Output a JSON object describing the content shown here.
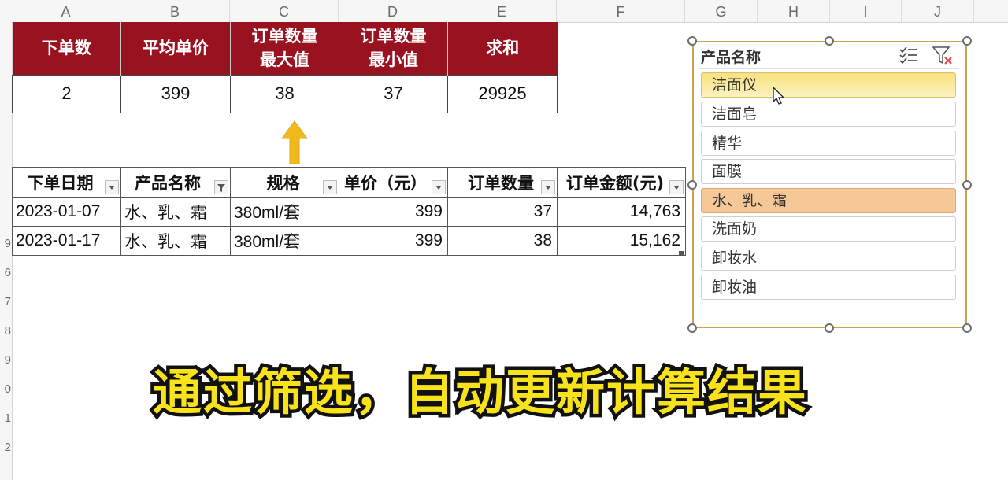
{
  "columns": [
    "A",
    "B",
    "C",
    "D",
    "E",
    "F",
    "G",
    "H",
    "I",
    "J"
  ],
  "rows": [
    "9",
    "6",
    "7",
    "8",
    "9",
    "0",
    "1",
    "2"
  ],
  "summary": {
    "headers": [
      [
        "下单数"
      ],
      [
        "平均单价"
      ],
      [
        "订单数量",
        "最大值"
      ],
      [
        "订单数量",
        "最小值"
      ],
      [
        "求和"
      ]
    ],
    "values": [
      "2",
      "399",
      "38",
      "37",
      "29925"
    ]
  },
  "table": {
    "headers": [
      "下单日期",
      "产品名称",
      "规格",
      "单价（元）",
      "订单数量",
      "订单金额(元)"
    ],
    "rows": [
      [
        "2023-01-07",
        "水、乳、霜",
        "380ml/套",
        "399",
        "37",
        "14,763"
      ],
      [
        "2023-01-17",
        "水、乳、霜",
        "380ml/套",
        "399",
        "38",
        "15,162"
      ]
    ]
  },
  "slicer": {
    "title": "产品名称",
    "items": [
      "洁面仪",
      "洁面皂",
      "精华",
      "面膜",
      "水、乳、霜",
      "洗面奶",
      "卸妆水",
      "卸妆油"
    ],
    "hovered": "洁面仪",
    "selected": "水、乳、霜",
    "multi_select_icon": "multi-select-icon",
    "clear_filter_icon": "clear-filter-icon"
  },
  "caption": "通过筛选，自动更新计算结果",
  "colors": {
    "header_red": "#98121f",
    "arrow": "#f2b91f",
    "caption_fill": "#f7e21b",
    "selected_item": "#f6c797"
  }
}
